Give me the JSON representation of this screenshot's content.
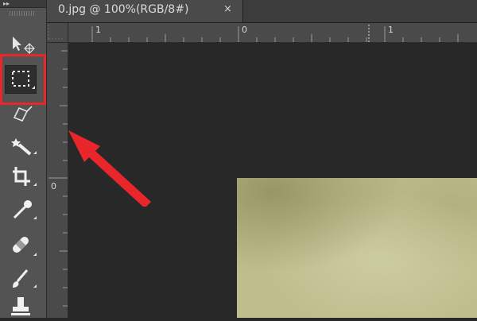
{
  "tab": {
    "title": "0.jpg @ 100%(RGB/8#)",
    "close_glyph": "×"
  },
  "toolbar": {
    "collapse_glyph": "▸▸",
    "tools": [
      {
        "icon": "move-tool-icon",
        "selected": false
      },
      {
        "icon": "rectangular-marquee-icon",
        "selected": true
      },
      {
        "icon": "lasso-tool-icon",
        "selected": false
      },
      {
        "icon": "magic-wand-icon",
        "selected": false
      },
      {
        "icon": "crop-tool-icon",
        "selected": false
      },
      {
        "icon": "eyedropper-icon",
        "selected": false
      },
      {
        "icon": "healing-brush-icon",
        "selected": false
      },
      {
        "icon": "brush-tool-icon",
        "selected": false
      },
      {
        "icon": "clone-stamp-icon",
        "selected": false
      }
    ]
  },
  "ruler_top": {
    "labels": [
      "1",
      "0",
      "1"
    ]
  },
  "ruler_left": {
    "labels": [
      "0"
    ]
  },
  "colors": {
    "highlight": "#e8262b",
    "arrow": "#e8262b",
    "image_base": "#bdbd8d"
  }
}
